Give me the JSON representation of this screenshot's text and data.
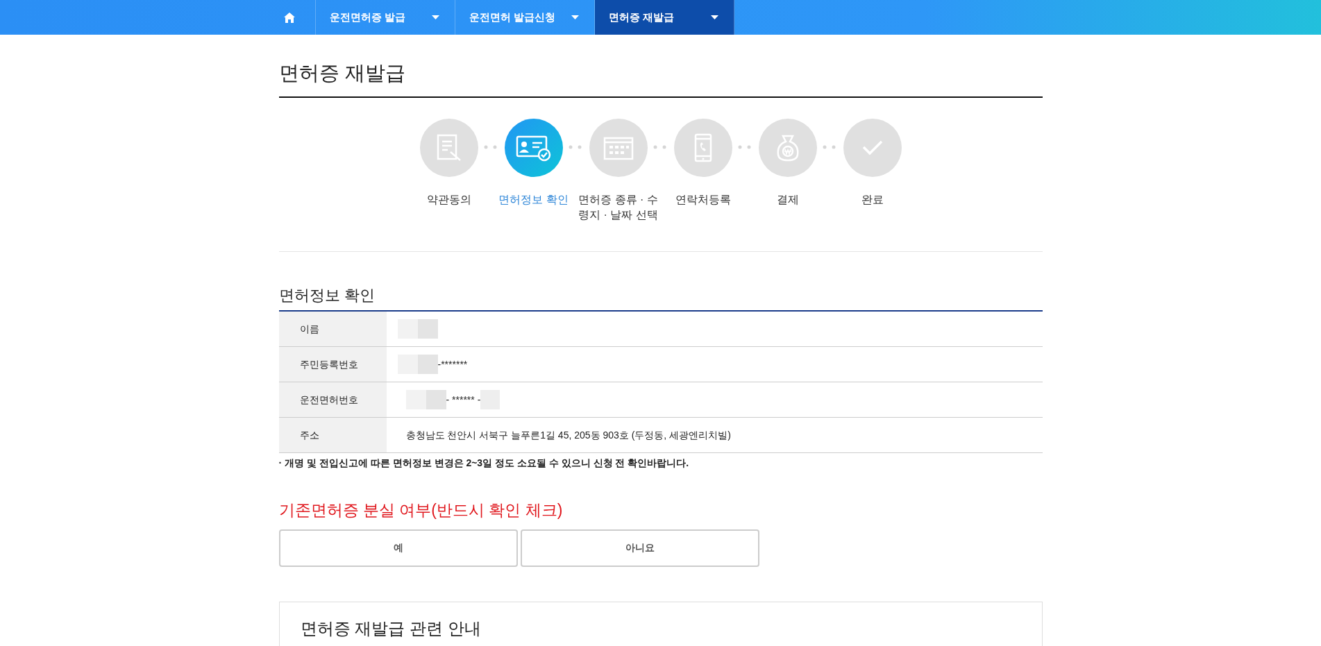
{
  "nav": {
    "items": [
      {
        "label": "운전면허증 발급",
        "selected": false
      },
      {
        "label": "운전면허 발급신청",
        "selected": false
      },
      {
        "label": "면허증 재발급",
        "selected": true
      }
    ]
  },
  "page_title": "면허증 재발급",
  "steps": [
    {
      "label": "약관동의",
      "selected": false
    },
    {
      "label": "면허정보 확인",
      "selected": true
    },
    {
      "label": "면허증 종류 · 수령지 · 날짜 선택",
      "selected": false
    },
    {
      "label": "연락처등록",
      "selected": false
    },
    {
      "label": "결제",
      "selected": false
    },
    {
      "label": "완료",
      "selected": false
    }
  ],
  "section_title": "면허정보 확인",
  "info_rows": [
    {
      "label": "이름",
      "value": [
        {
          "kind": "blur"
        }
      ]
    },
    {
      "label": "주민등록번호",
      "value": [
        {
          "kind": "blur"
        },
        {
          "kind": "text",
          "text": "-*******"
        }
      ]
    },
    {
      "label": "운전면허번호",
      "value": [
        {
          "kind": "blur"
        },
        {
          "kind": "text",
          "text": "- ****** -"
        },
        {
          "kind": "blur"
        }
      ]
    },
    {
      "label": "주소",
      "value": [
        {
          "kind": "text",
          "text": "충청남도 천안시 서북구 늘푸른1길 45, 205동 903호 (두정동, 세광엔리치빌)"
        }
      ]
    }
  ],
  "note": "· 개명 및 전입신고에 따른 면허정보 변경은 2~3일 정도 소요될 수 있으니 신청 전 확인바랍니다.",
  "loss_question": {
    "title": "기존면허증 분실 여부(반드시 확인 체크)",
    "options": [
      {
        "label": "예",
        "selected": false
      },
      {
        "label": "아니요",
        "selected": false
      }
    ]
  },
  "guide": {
    "title": "면허증 재발급 관련 안내"
  }
}
